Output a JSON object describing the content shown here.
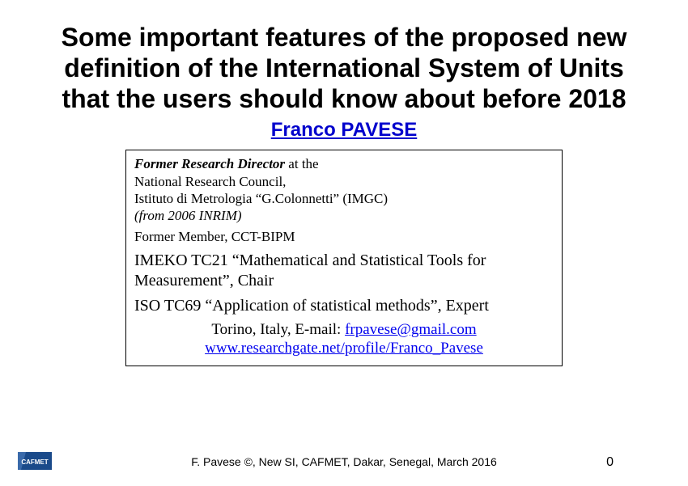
{
  "title": "Some important features of the proposed new definition of the International System of Units that the users should know about before 2018",
  "author": "Franco PAVESE",
  "info": {
    "role_bold": "Former Research Director",
    "role_suffix": " at the",
    "org1": "National Research Council,",
    "org2_prefix": "Istituto di Metrologia ",
    "org2_quote": "“G.Colonnetti”",
    "org2_suffix": " (IMGC)",
    "from": "(from 2006 INRIM)",
    "member": "Former Member, CCT-BIPM",
    "imeko": "IMEKO TC21 “Mathematical and Statistical Tools for Measurement”, Chair",
    "iso": "ISO TC69 “Application of statistical methods”, Expert",
    "contact_prefix": "Torino, Italy, E-mail: ",
    "email": "frpavese@gmail.com",
    "url": "www.researchgate.net/profile/Franco_Pavese"
  },
  "footer": "F. Pavese ©, New SI, CAFMET, Dakar, Senegal, March 2016",
  "page_number": "0",
  "logo_text": "CAFMET"
}
